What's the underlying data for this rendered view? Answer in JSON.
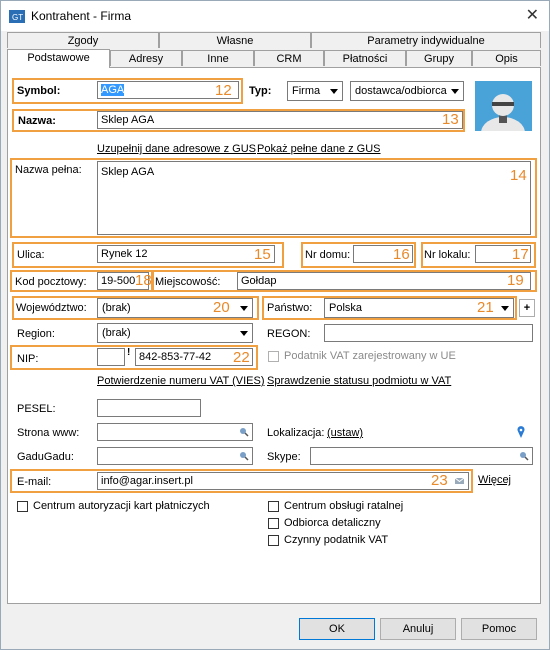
{
  "window": {
    "title": "Kontrahent - Firma",
    "close_glyph": "✕"
  },
  "tabs_row1": [
    "Zgody",
    "Własne",
    "Parametry indywidualne"
  ],
  "tabs_row2": [
    "Podstawowe",
    "Adresy",
    "Inne",
    "CRM",
    "Płatności",
    "Grupy",
    "Opis"
  ],
  "labels": {
    "symbol": "Symbol:",
    "typ": "Typ:",
    "nazwa": "Nazwa:",
    "nazwa_pelna": "Nazwa pełna:",
    "ulica": "Ulica:",
    "nr_domu": "Nr domu:",
    "nr_lokalu": "Nr lokalu:",
    "kod_pocztowy": "Kod pocztowy:",
    "miejscowosc": "Miejscowość:",
    "wojewodztwo": "Województwo:",
    "panstwo": "Państwo:",
    "region": "Region:",
    "regon": "REGON:",
    "nip": "NIP:",
    "pesel": "PESEL:",
    "strona_www": "Strona www:",
    "lokalizacja": "Lokalizacja:",
    "gadugadu": "GaduGadu:",
    "skype": "Skype:",
    "email": "E-mail:"
  },
  "values": {
    "symbol": "AGA",
    "typ": "Firma",
    "rola": "dostawca/odbiorca",
    "nazwa": "Sklep AGA",
    "nazwa_pelna": "Sklep AGA",
    "ulica": "Rynek 12",
    "nr_domu": "",
    "nr_lokalu": "",
    "kod_pocztowy": "19-500",
    "miejscowosc": "Gołdap",
    "wojewodztwo": "(brak)",
    "panstwo": "Polska",
    "region": "(brak)",
    "regon": "",
    "nip_prefix": "",
    "nip": "842-853-77-42",
    "pesel": "",
    "strona_www": "",
    "lokalizacja": "(ustaw)",
    "gadugadu": "",
    "skype": "",
    "email": "info@agar.insert.pl"
  },
  "links": {
    "uzupelnij_gus": "Uzupełnij dane adresowe z GUS",
    "pokaz_gus": "Pokaż pełne dane z GUS",
    "vies": "Potwierdzenie numeru VAT (VIES)",
    "status_vat": "Sprawdzenie statusu podmiotu w VAT",
    "wiecej": "Więcej"
  },
  "checkboxes": {
    "podatnik_ue": "Podatnik VAT zarejestrowany w UE",
    "centrum_kart": "Centrum autoryzacji kart płatniczych",
    "centrum_ratalnej": "Centrum obsługi ratalnej",
    "odbiorca_detaliczny": "Odbiorca detaliczny",
    "czynny_vat": "Czynny podatnik VAT"
  },
  "annotations": [
    "12",
    "13",
    "14",
    "15",
    "16",
    "17",
    "18",
    "19",
    "20",
    "21",
    "22",
    "23"
  ],
  "buttons": {
    "ok": "OK",
    "anuluj": "Anuluj",
    "pomoc": "Pomoc",
    "plus": "+",
    "nip_warn": "!"
  },
  "colors": {
    "annotation": "#e8892a",
    "selection": "#3399ff",
    "link_icon": "#2a7bd4"
  }
}
